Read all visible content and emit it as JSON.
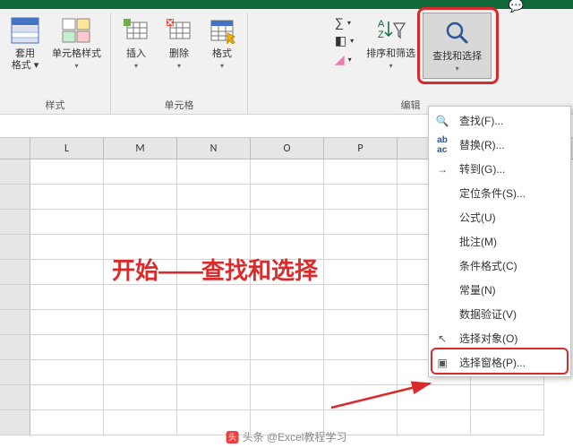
{
  "ribbon": {
    "group_styles": {
      "btn1_line1": "套用",
      "btn1_line2": "格式 ▾",
      "btn2": "单元格样式",
      "label": "样式"
    },
    "group_cells": {
      "insert": "插入",
      "delete": "删除",
      "format": "格式",
      "label": "单元格"
    },
    "group_editing": {
      "sort": "排序和筛选",
      "find": "查找和选择",
      "label": "编辑"
    }
  },
  "columns": [
    "L",
    "M",
    "N",
    "O",
    "P"
  ],
  "overlay": {
    "part1": "开始",
    "dash": "——",
    "part2": "查找和选择"
  },
  "dropdown": {
    "find": "查找(F)...",
    "replace": "替换(R)...",
    "goto": "转到(G)...",
    "special": "定位条件(S)...",
    "formulas": "公式(U)",
    "comments": "批注(M)",
    "condfmt": "条件格式(C)",
    "constants": "常量(N)",
    "validation": "数据验证(V)",
    "selobj": "选择对象(O)",
    "selpane": "选择窗格(P)..."
  },
  "credit": "头条 @Excel教程学习"
}
